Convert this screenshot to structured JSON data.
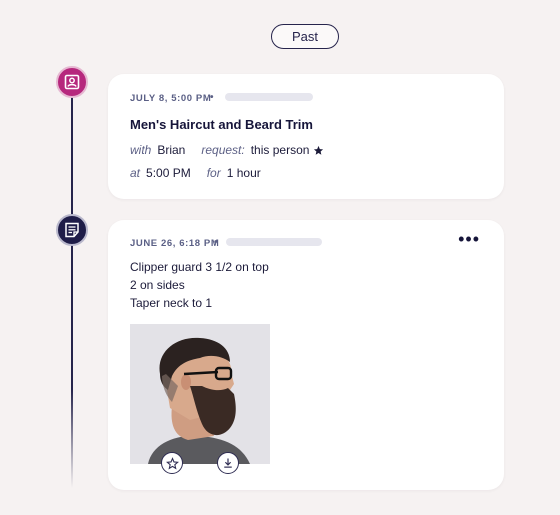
{
  "filter": {
    "past_label": "Past"
  },
  "appointment": {
    "date_time": "JULY 8, 5:00 PM",
    "separator": "•",
    "title": "Men's Haircut and Beard Trim",
    "with_label": "with",
    "provider": "Brian",
    "request_label": "request:",
    "request_value": "this person",
    "at_label": "at",
    "time": "5:00 PM",
    "for_label": "for",
    "duration": "1 hour"
  },
  "note": {
    "date_time": "JUNE 26, 6:18 PM",
    "separator": "•",
    "more_label": "•••",
    "lines": [
      "Clipper guard 3 1/2 on top",
      "2 on sides",
      "Taper neck to 1"
    ]
  },
  "icons": {
    "appointment": "appointment-icon",
    "note": "note-icon",
    "request_star": "star-icon",
    "favorite": "star-outline-icon",
    "download": "download-icon"
  },
  "colors": {
    "background": "#f6f2f2",
    "navy": "#1f1d48",
    "magenta": "#b6287d",
    "muted_text": "#5a5f85"
  }
}
